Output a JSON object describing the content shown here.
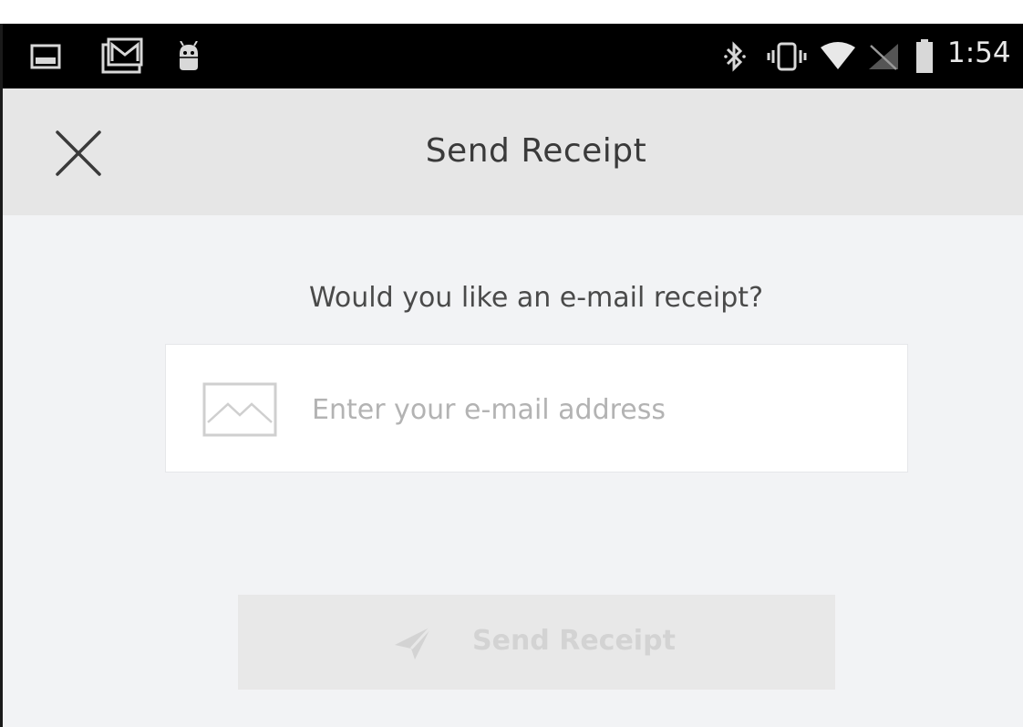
{
  "status_bar": {
    "time": "1:54",
    "left_icons": [
      "image-notification-icon",
      "gmail-icon",
      "android-icon"
    ],
    "right_icons": [
      "bluetooth-icon",
      "vibrate-icon",
      "wifi-icon",
      "no-signal-icon",
      "battery-icon"
    ],
    "background": "#000000"
  },
  "app_bar": {
    "title": "Send Receipt",
    "close_icon": "close-icon",
    "background": "#e6e6e6"
  },
  "content": {
    "prompt": "Would you like an e-mail receipt?",
    "email_field": {
      "placeholder": "Enter your e-mail address",
      "value": "",
      "icon": "envelope-icon"
    },
    "send_button": {
      "label": "Send Receipt",
      "icon": "paper-plane-icon",
      "state": "disabled"
    },
    "background": "#f2f3f5"
  }
}
